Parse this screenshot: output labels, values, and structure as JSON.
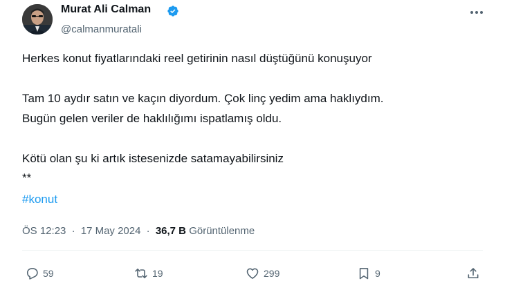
{
  "author": {
    "name": "Murat Ali Calman",
    "handle": "@calmanmuratali"
  },
  "tweet": {
    "line1": "Herkes konut fiyatlarındaki reel getirinin nasıl düştüğünü konuşuyor",
    "line2": "Tam 10 aydır satın ve kaçın diyordum. Çok linç yedim ama haklıydım.",
    "line3": "Bugün gelen veriler de haklılığımı ispatlamış oldu.",
    "line4": "Kötü olan şu ki artık istesenizde satamayabilirsiniz",
    "line5": "**",
    "hashtag": "#konut"
  },
  "meta": {
    "time": "ÖS 12:23",
    "separator": "·",
    "date": "17 May 2024",
    "views_count": "36,7 B",
    "views_label": "Görüntülenme"
  },
  "actions": {
    "replies": "59",
    "retweets": "19",
    "likes": "299",
    "bookmarks": "9"
  },
  "icons": {
    "verified": "verified-badge-icon",
    "more": "more-options-icon",
    "reply": "reply-icon",
    "retweet": "retweet-icon",
    "like": "heart-icon",
    "bookmark": "bookmark-icon",
    "share": "share-icon"
  },
  "colors": {
    "accent": "#1d9bf0",
    "text": "#0f1419",
    "muted": "#536471"
  }
}
